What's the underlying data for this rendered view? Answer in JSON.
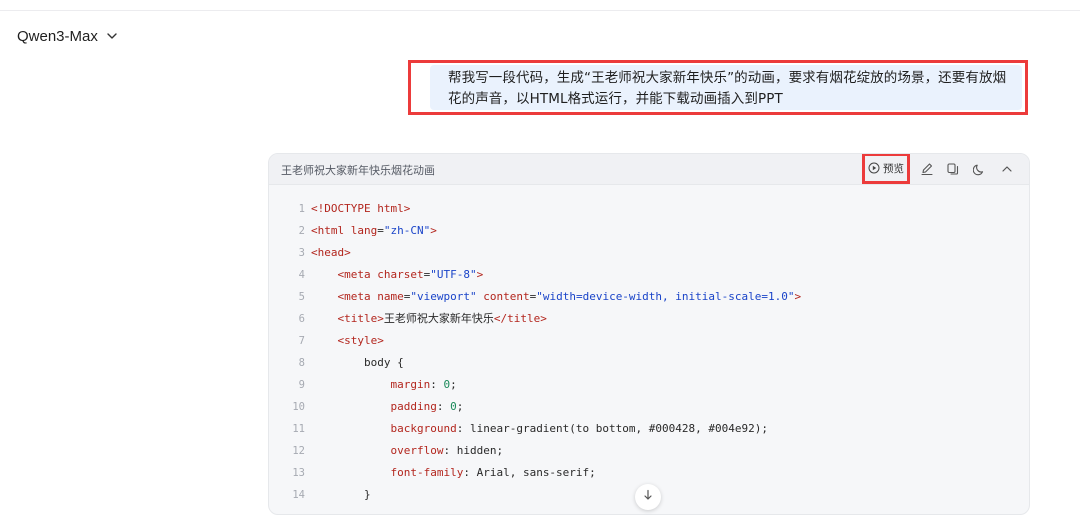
{
  "header": {
    "model_name": "Qwen3-Max"
  },
  "user_message": {
    "text": "帮我写一段代码，生成“王老师祝大家新年快乐”的动画，要求有烟花绽放的场景，还要有放烟花的声音，以HTML格式运行，并能下载动画插入到PPT"
  },
  "code_block": {
    "title": "王老师祝大家新年快乐烟花动画",
    "preview_label": "预览",
    "toolbar_icons": [
      "preview-play-icon",
      "edit-icon",
      "copy-icon",
      "theme-moon-icon",
      "collapse-chevron-up-icon"
    ],
    "lines": [
      {
        "n": "1",
        "tokens": [
          {
            "t": "<!DOCTYPE html>",
            "c": "tag"
          }
        ]
      },
      {
        "n": "2",
        "tokens": [
          {
            "t": "<html ",
            "c": "tag"
          },
          {
            "t": "lang",
            "c": "attr"
          },
          {
            "t": "=",
            "c": "plain"
          },
          {
            "t": "\"zh-CN\"",
            "c": "str"
          },
          {
            "t": ">",
            "c": "tag"
          }
        ]
      },
      {
        "n": "3",
        "tokens": [
          {
            "t": "<head>",
            "c": "tag"
          }
        ]
      },
      {
        "n": "4",
        "tokens": [
          {
            "t": "    ",
            "c": "plain"
          },
          {
            "t": "<meta ",
            "c": "tag"
          },
          {
            "t": "charset",
            "c": "attr"
          },
          {
            "t": "=",
            "c": "plain"
          },
          {
            "t": "\"UTF-8\"",
            "c": "str"
          },
          {
            "t": ">",
            "c": "tag"
          }
        ]
      },
      {
        "n": "5",
        "tokens": [
          {
            "t": "    ",
            "c": "plain"
          },
          {
            "t": "<meta ",
            "c": "tag"
          },
          {
            "t": "name",
            "c": "attr"
          },
          {
            "t": "=",
            "c": "plain"
          },
          {
            "t": "\"viewport\"",
            "c": "str"
          },
          {
            "t": " ",
            "c": "plain"
          },
          {
            "t": "content",
            "c": "attr"
          },
          {
            "t": "=",
            "c": "plain"
          },
          {
            "t": "\"width=device-width, initial-scale=1.0\"",
            "c": "str"
          },
          {
            "t": ">",
            "c": "tag"
          }
        ]
      },
      {
        "n": "6",
        "tokens": [
          {
            "t": "    ",
            "c": "plain"
          },
          {
            "t": "<title>",
            "c": "tag"
          },
          {
            "t": "王老师祝大家新年快乐",
            "c": "plain"
          },
          {
            "t": "</title>",
            "c": "tag"
          }
        ]
      },
      {
        "n": "7",
        "tokens": [
          {
            "t": "    ",
            "c": "plain"
          },
          {
            "t": "<style>",
            "c": "tag"
          }
        ]
      },
      {
        "n": "8",
        "tokens": [
          {
            "t": "        body {",
            "c": "plain"
          }
        ]
      },
      {
        "n": "9",
        "tokens": [
          {
            "t": "            ",
            "c": "plain"
          },
          {
            "t": "margin",
            "c": "attr"
          },
          {
            "t": ": ",
            "c": "plain"
          },
          {
            "t": "0",
            "c": "num"
          },
          {
            "t": ";",
            "c": "plain"
          }
        ]
      },
      {
        "n": "10",
        "tokens": [
          {
            "t": "            ",
            "c": "plain"
          },
          {
            "t": "padding",
            "c": "attr"
          },
          {
            "t": ": ",
            "c": "plain"
          },
          {
            "t": "0",
            "c": "num"
          },
          {
            "t": ";",
            "c": "plain"
          }
        ]
      },
      {
        "n": "11",
        "tokens": [
          {
            "t": "            ",
            "c": "plain"
          },
          {
            "t": "background",
            "c": "attr"
          },
          {
            "t": ": linear-gradient(to bottom, #000428, #004e92);",
            "c": "plain"
          }
        ]
      },
      {
        "n": "12",
        "tokens": [
          {
            "t": "            ",
            "c": "plain"
          },
          {
            "t": "overflow",
            "c": "attr"
          },
          {
            "t": ": hidden;",
            "c": "plain"
          }
        ]
      },
      {
        "n": "13",
        "tokens": [
          {
            "t": "            ",
            "c": "plain"
          },
          {
            "t": "font-family",
            "c": "attr"
          },
          {
            "t": ": Arial, sans-serif;",
            "c": "plain"
          }
        ]
      },
      {
        "n": "14",
        "tokens": [
          {
            "t": "        }",
            "c": "plain"
          }
        ]
      }
    ]
  },
  "colors": {
    "highlight_border": "#ec3b3b",
    "user_bubble_bg": "#eaf2fd",
    "code_bg": "#f6f7f9",
    "token_tag": "#b3261e",
    "token_string": "#1a44c9",
    "token_number": "#1a8a5a"
  }
}
